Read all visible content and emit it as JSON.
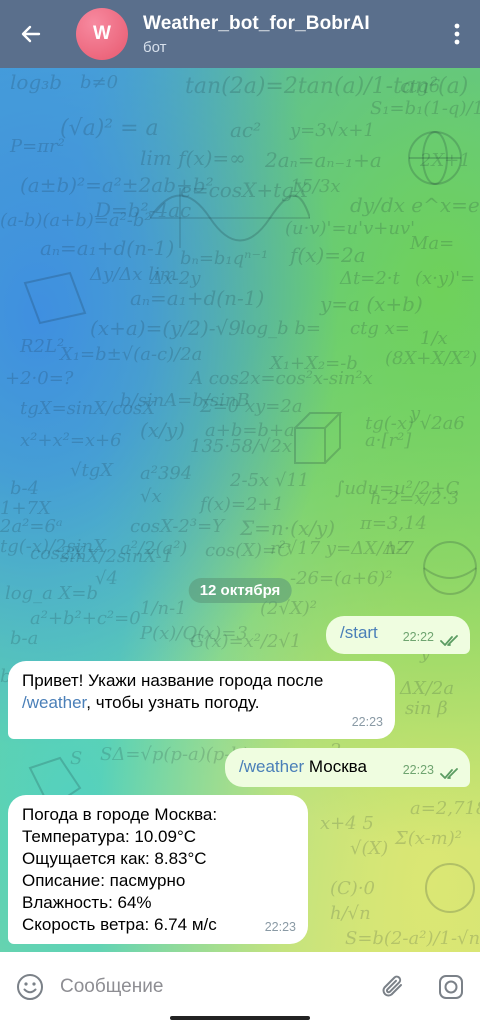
{
  "header": {
    "title": "Weather_bot_for_BobrAI",
    "subtitle": "бот",
    "avatar_letter": "W"
  },
  "chat": {
    "date_separator": "12 октября",
    "messages": [
      {
        "dir": "out",
        "text": "/start",
        "time": "22:22",
        "status": "read"
      },
      {
        "dir": "in",
        "line1": "Привет! Укажи название города после",
        "cmd": "/weather",
        "line2_rest": ", чтобы узнать погоду.",
        "time": "22:23"
      },
      {
        "dir": "out",
        "cmd": "/weather",
        "text_rest": " Москва",
        "time": "22:23",
        "status": "read"
      },
      {
        "dir": "in",
        "lines": [
          "Погода в городе Москва:",
          "Температура: 10.09°C",
          "Ощущается как: 8.83°C",
          "Описание: пасмурно",
          "Влажность: 64%",
          "Скорость ветра: 6.74 м/с"
        ],
        "time": "22:23"
      }
    ]
  },
  "input": {
    "placeholder": "Сообщение"
  },
  "colors": {
    "header_bg": "#5a6f8c",
    "outgoing_bubble": "#effde0",
    "incoming_bubble": "#ffffff",
    "command_link": "#4a7fb8"
  },
  "icons": [
    "back-arrow-icon",
    "more-vertical-icon",
    "emoji-icon",
    "attach-icon",
    "camera-icon",
    "double-check-icon"
  ]
}
